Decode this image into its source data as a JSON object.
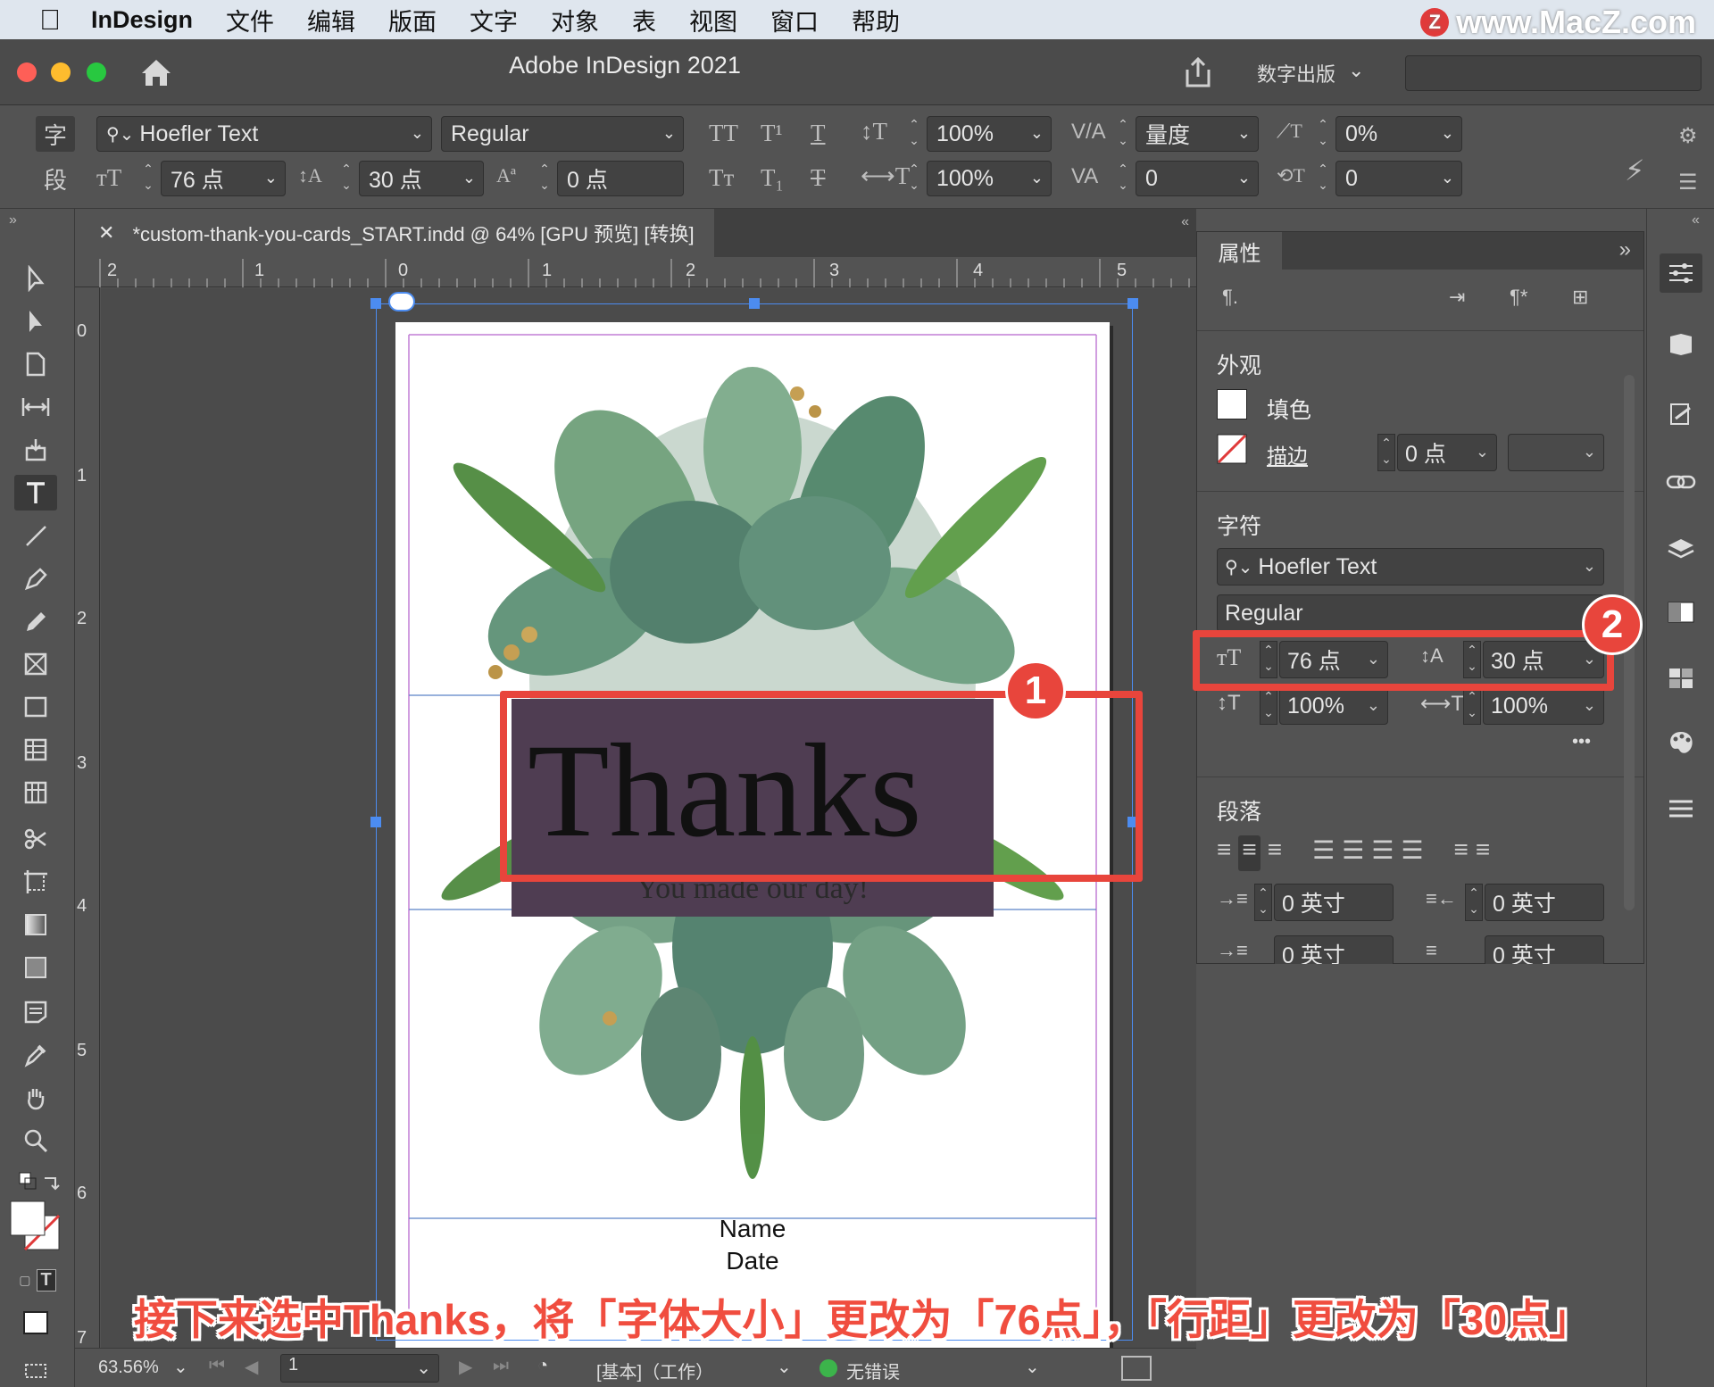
{
  "menubar": {
    "app_name": "InDesign",
    "items": [
      "文件",
      "编辑",
      "版面",
      "文字",
      "对象",
      "表",
      "视图",
      "窗口",
      "帮助"
    ],
    "watermark": "www.MacZ.com",
    "watermark_logo": "Z"
  },
  "titlebar": {
    "title": "Adobe InDesign 2021",
    "workspace": "数字出版"
  },
  "control": {
    "tab_char": "字",
    "tab_para": "段",
    "font_family": "Hoefler Text",
    "font_style": "Regular",
    "font_size": "76 点",
    "leading": "30 点",
    "baseline_shift": "0 点",
    "vertical_scale": "100%",
    "horizontal_scale": "100%",
    "kerning": "量度",
    "tracking": "0",
    "skew": "0%",
    "char_rotation": "0"
  },
  "document": {
    "tab_title": "*custom-thank-you-cards_START.indd @ 64% [GPU 预览] [转换]",
    "ruler_top": [
      "2",
      "1",
      "0",
      "1",
      "2",
      "3",
      "4",
      "5"
    ],
    "ruler_left": [
      "0",
      "1",
      "2",
      "3",
      "4",
      "5",
      "6",
      "7"
    ],
    "card": {
      "headline": "Thanks",
      "subline": "You made our day!",
      "name_label": "Name",
      "date_label": "Date"
    }
  },
  "statusbar": {
    "zoom": "63.56%",
    "page": "1",
    "preflight_profile": "[基本]（工作）",
    "preflight_status": "无错误"
  },
  "properties_panel": {
    "tab_label": "属性",
    "appearance_title": "外观",
    "fill_label": "填色",
    "stroke_label": "描边",
    "stroke_weight": "0 点",
    "character_title": "字符",
    "font_family": "Hoefler Text",
    "font_style": "Regular",
    "font_size": "76 点",
    "leading": "30 点",
    "vertical_scale": "100%",
    "horizontal_scale": "100%",
    "paragraph_title": "段落",
    "left_indent": "0 英寸",
    "right_indent": "0 英寸",
    "first_line_indent": "0 英寸",
    "last_line_indent": "0 英寸",
    "more": "•••"
  },
  "annotations": {
    "badge1": "1",
    "badge2": "2",
    "caption": "接下来选中Thanks，将「字体大小」更改为「76点」，「行距」更改为「30点」",
    "color": "#e8453c"
  }
}
